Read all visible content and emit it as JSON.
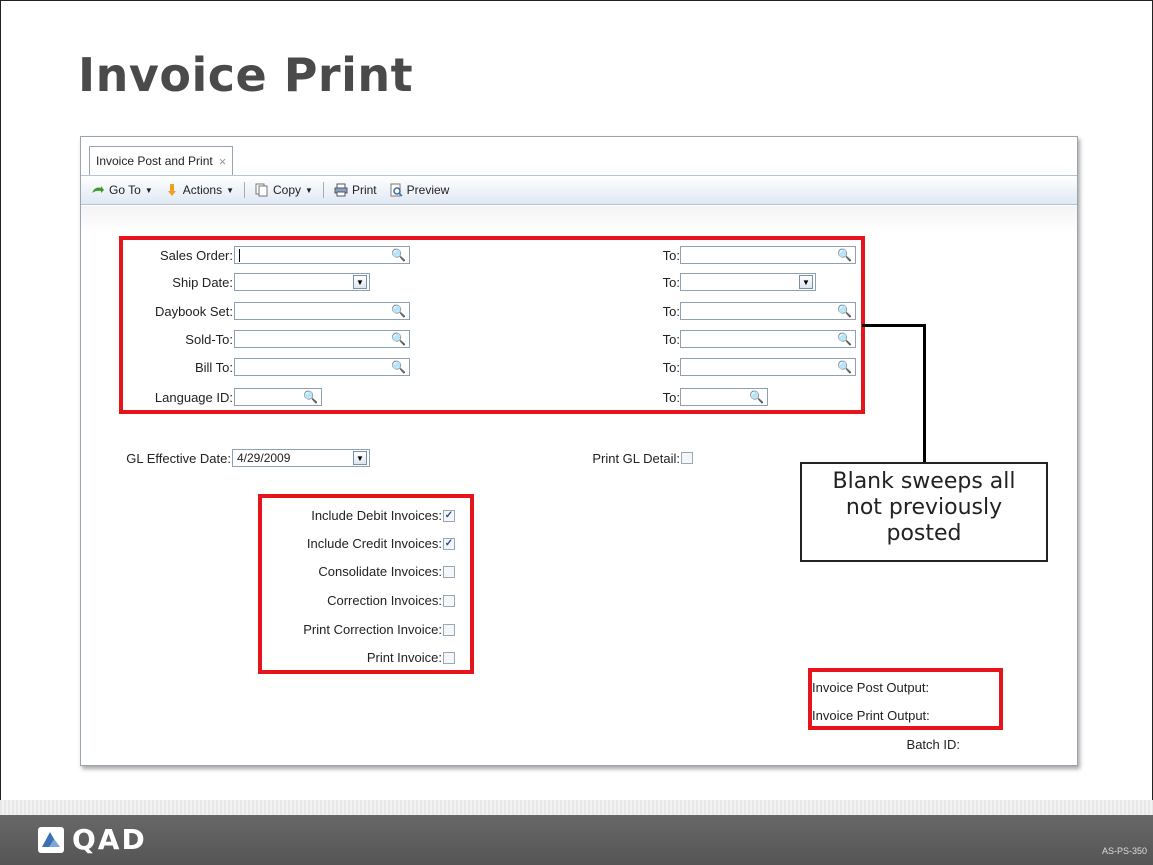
{
  "slide": {
    "title": "Invoice Print",
    "code": "AS-PS-350",
    "logo": "QAD"
  },
  "tab": {
    "label": "Invoice Post and Print",
    "close": "×"
  },
  "toolbar": {
    "goto": "Go To",
    "actions": "Actions",
    "copy": "Copy",
    "print": "Print",
    "preview": "Preview"
  },
  "form": {
    "to_label": "To:",
    "rows": [
      {
        "label": "Sales Order:",
        "from": "",
        "to": ""
      },
      {
        "label": "Ship Date:",
        "from": "",
        "to": ""
      },
      {
        "label": "Daybook Set:",
        "from": "",
        "to": ""
      },
      {
        "label": "Sold-To:",
        "from": "",
        "to": ""
      },
      {
        "label": "Bill To:",
        "from": "",
        "to": ""
      },
      {
        "label": "Language ID:",
        "from": "",
        "to": ""
      }
    ],
    "gl_effective_label": "GL Effective Date:",
    "gl_effective_value": "4/29/2009",
    "print_gl_detail_label": "Print GL Detail:",
    "print_gl_detail": false,
    "options": [
      {
        "label": "Include Debit Invoices:",
        "checked": true
      },
      {
        "label": "Include Credit Invoices:",
        "checked": true
      },
      {
        "label": "Consolidate Invoices:",
        "checked": false
      },
      {
        "label": "Correction Invoices:",
        "checked": false
      },
      {
        "label": "Print Correction Invoice:",
        "checked": false
      },
      {
        "label": "Print Invoice:",
        "checked": false
      }
    ],
    "outputs": {
      "post": "Invoice Post Output:",
      "print": "Invoice Print Output:",
      "batch": "Batch ID:"
    }
  },
  "callout": {
    "line1": "Blank sweeps all",
    "line2": "not previously",
    "line3": "posted"
  },
  "colors": {
    "highlight": "#e8141c",
    "toolbar_gradient_end": "#dfe8f3"
  },
  "icons": [
    "goto-icon",
    "actions-icon",
    "copy-icon",
    "print-icon",
    "preview-icon",
    "lookup-icon",
    "dropdown-icon",
    "close-icon",
    "qad-logo-icon"
  ]
}
